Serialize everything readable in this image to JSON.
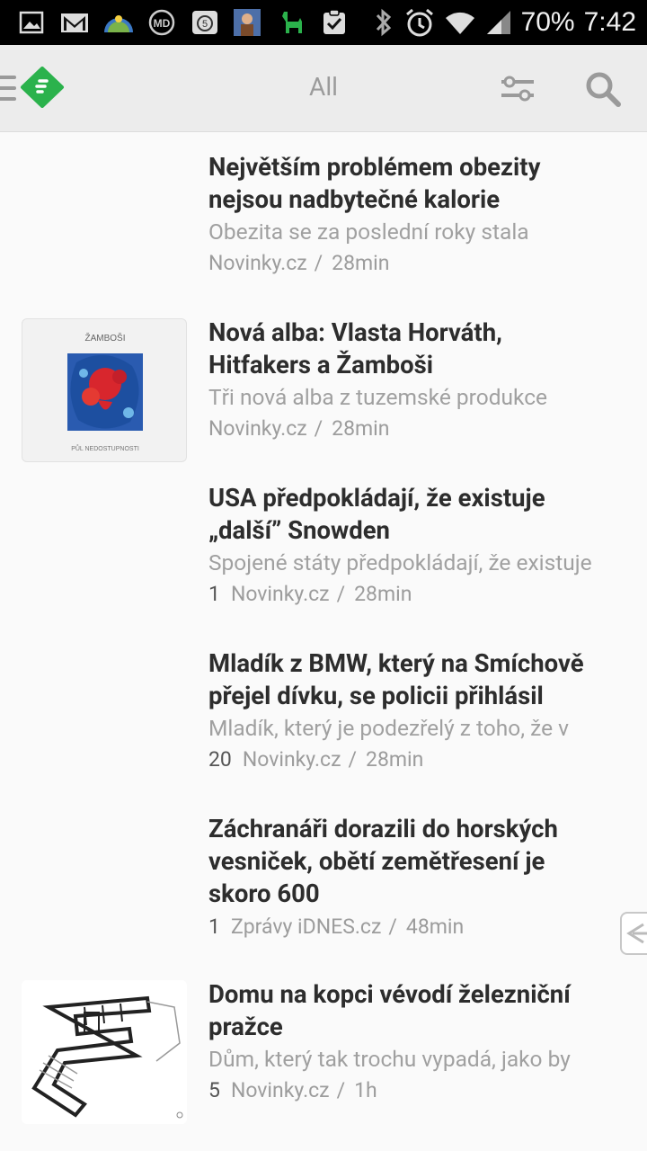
{
  "status_bar": {
    "battery": "70%",
    "time": "7:42",
    "notification_icons": [
      "gallery-icon",
      "gmail-icon",
      "weather-icon",
      "md-icon",
      "badge-5-icon",
      "portrait-icon",
      "alpaca-icon",
      "clipboard-check-icon"
    ],
    "badge_number": "5"
  },
  "app_bar": {
    "title": "All"
  },
  "articles": [
    {
      "headline_lines": [
        "Největším problémem obezity",
        "nejsou nadbytečné kalorie"
      ],
      "summary": "Obezita se za poslední roky stala",
      "count": "",
      "source": "Novinky.cz",
      "time": "28min",
      "has_thumbnail": false
    },
    {
      "headline_lines": [
        "Nová alba: Vlasta Horváth,",
        "Hitfakers a Žamboši"
      ],
      "summary": "Tři nová alba z tuzemské produkce",
      "count": "",
      "source": "Novinky.cz",
      "time": "28min",
      "has_thumbnail": true,
      "thumbnail_caption_top": "ŽAMBOŠI",
      "thumbnail_caption_bottom": "PŮL NEDOSTUPNOSTI"
    },
    {
      "headline_lines": [
        "USA předpokládají, že existuje",
        "„další” Snowden"
      ],
      "summary": "Spojené státy předpokládají, že existuje",
      "count": "1",
      "source": "Novinky.cz",
      "time": "28min",
      "has_thumbnail": false
    },
    {
      "headline_lines": [
        "Mladík z BMW, který na Smíchově",
        "přejel dívku, se policii přihlásil"
      ],
      "summary": "Mladík, který je podezřelý z toho, že v",
      "count": "20",
      "source": "Novinky.cz",
      "time": "28min",
      "has_thumbnail": false
    },
    {
      "headline_lines": [
        "Záchranáři dorazili do horských",
        "vesniček, obětí zemětřesení je",
        "skoro 600"
      ],
      "summary": "",
      "count": "1",
      "source": "Zprávy iDNES.cz",
      "time": "48min",
      "has_thumbnail": false
    },
    {
      "headline_lines": [
        "Domu na kopci vévodí železniční",
        "pražce"
      ],
      "summary": "Dům, který tak trochu vypadá, jako by",
      "count": "5",
      "source": "Novinky.cz",
      "time": "1h",
      "has_thumbnail": true
    }
  ],
  "colors": {
    "status_bar_bg": "#000000",
    "app_bar_bg": "#ececec",
    "brand_green": "#2bb24c",
    "headline": "#2d2d2d",
    "secondary": "#a0a0a0"
  }
}
